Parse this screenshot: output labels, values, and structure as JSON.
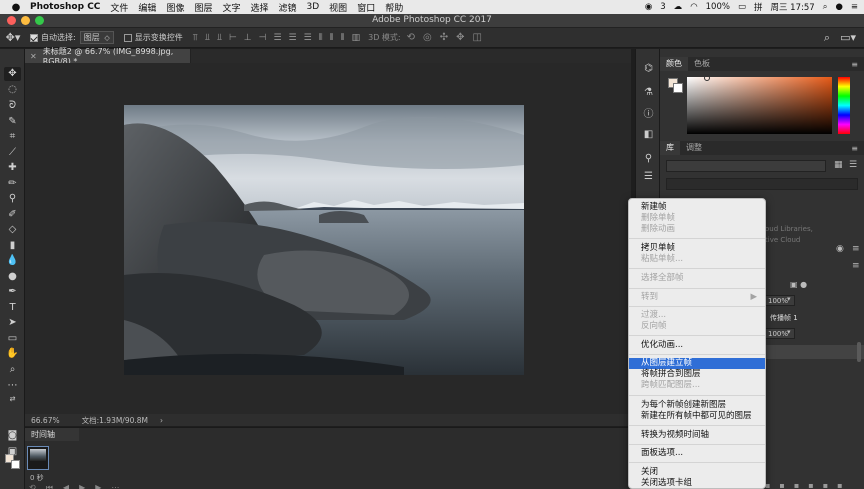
{
  "menubar": {
    "app_name": "Photoshop CC",
    "items": [
      "文件",
      "编辑",
      "图像",
      "图层",
      "文字",
      "选择",
      "滤镜",
      "3D",
      "视图",
      "窗口",
      "帮助"
    ],
    "notification_count": "3",
    "battery": "100%",
    "input_method": "拼",
    "datetime": "周三 17:57"
  },
  "window": {
    "title": "Adobe Photoshop CC 2017"
  },
  "options_bar": {
    "auto_select_label": "自动选择:",
    "auto_select_value": "图层",
    "show_transform_label": "显示变换控件",
    "mode_3d_label": "3D 模式:"
  },
  "document": {
    "tab_title": "未标题2 @ 66.7% (IMG_8998.jpg, RGB/8) *",
    "zoom": "66.67%",
    "doc_size": "文档:1.93M/90.8M"
  },
  "timeline": {
    "title": "时间轴",
    "frame_time": "0 秒"
  },
  "panels": {
    "color_tabs": [
      "颜色",
      "色板"
    ],
    "library_tabs": [
      "库",
      "调整"
    ],
    "library_info": [
      "oud Libraries,",
      "tive Cloud"
    ],
    "layer_rows": [
      "100%",
      "传播帧 1",
      "100%"
    ]
  },
  "context_menu": {
    "items": [
      {
        "label": "新建帧",
        "enabled": true
      },
      {
        "label": "删除单帧",
        "enabled": false
      },
      {
        "label": "删除动画",
        "enabled": false
      },
      {
        "label": "拷贝单帧",
        "enabled": true
      },
      {
        "label": "粘贴单帧...",
        "enabled": false
      },
      {
        "label": "选择全部帧",
        "enabled": false
      },
      {
        "label": "转到",
        "enabled": false
      },
      {
        "label": "过渡...",
        "enabled": false
      },
      {
        "label": "反向帧",
        "enabled": false
      },
      {
        "label": "优化动画...",
        "enabled": true
      },
      {
        "label": "从图层建立帧",
        "enabled": true,
        "highlighted": true
      },
      {
        "label": "将帧拼合到图层",
        "enabled": true
      },
      {
        "label": "跨帧匹配图层...",
        "enabled": false
      },
      {
        "label": "为每个新帧创建新图层",
        "enabled": true
      },
      {
        "label": "新建在所有帧中都可见的图层",
        "enabled": true
      },
      {
        "label": "转换为视频时间轴",
        "enabled": true
      },
      {
        "label": "面板选项...",
        "enabled": true
      },
      {
        "label": "关闭",
        "enabled": true
      },
      {
        "label": "关闭选项卡组",
        "enabled": true
      }
    ]
  },
  "colors": {
    "foreground": "#f3e5d6",
    "background": "#ffffff",
    "highlight": "#2f6ed6"
  }
}
